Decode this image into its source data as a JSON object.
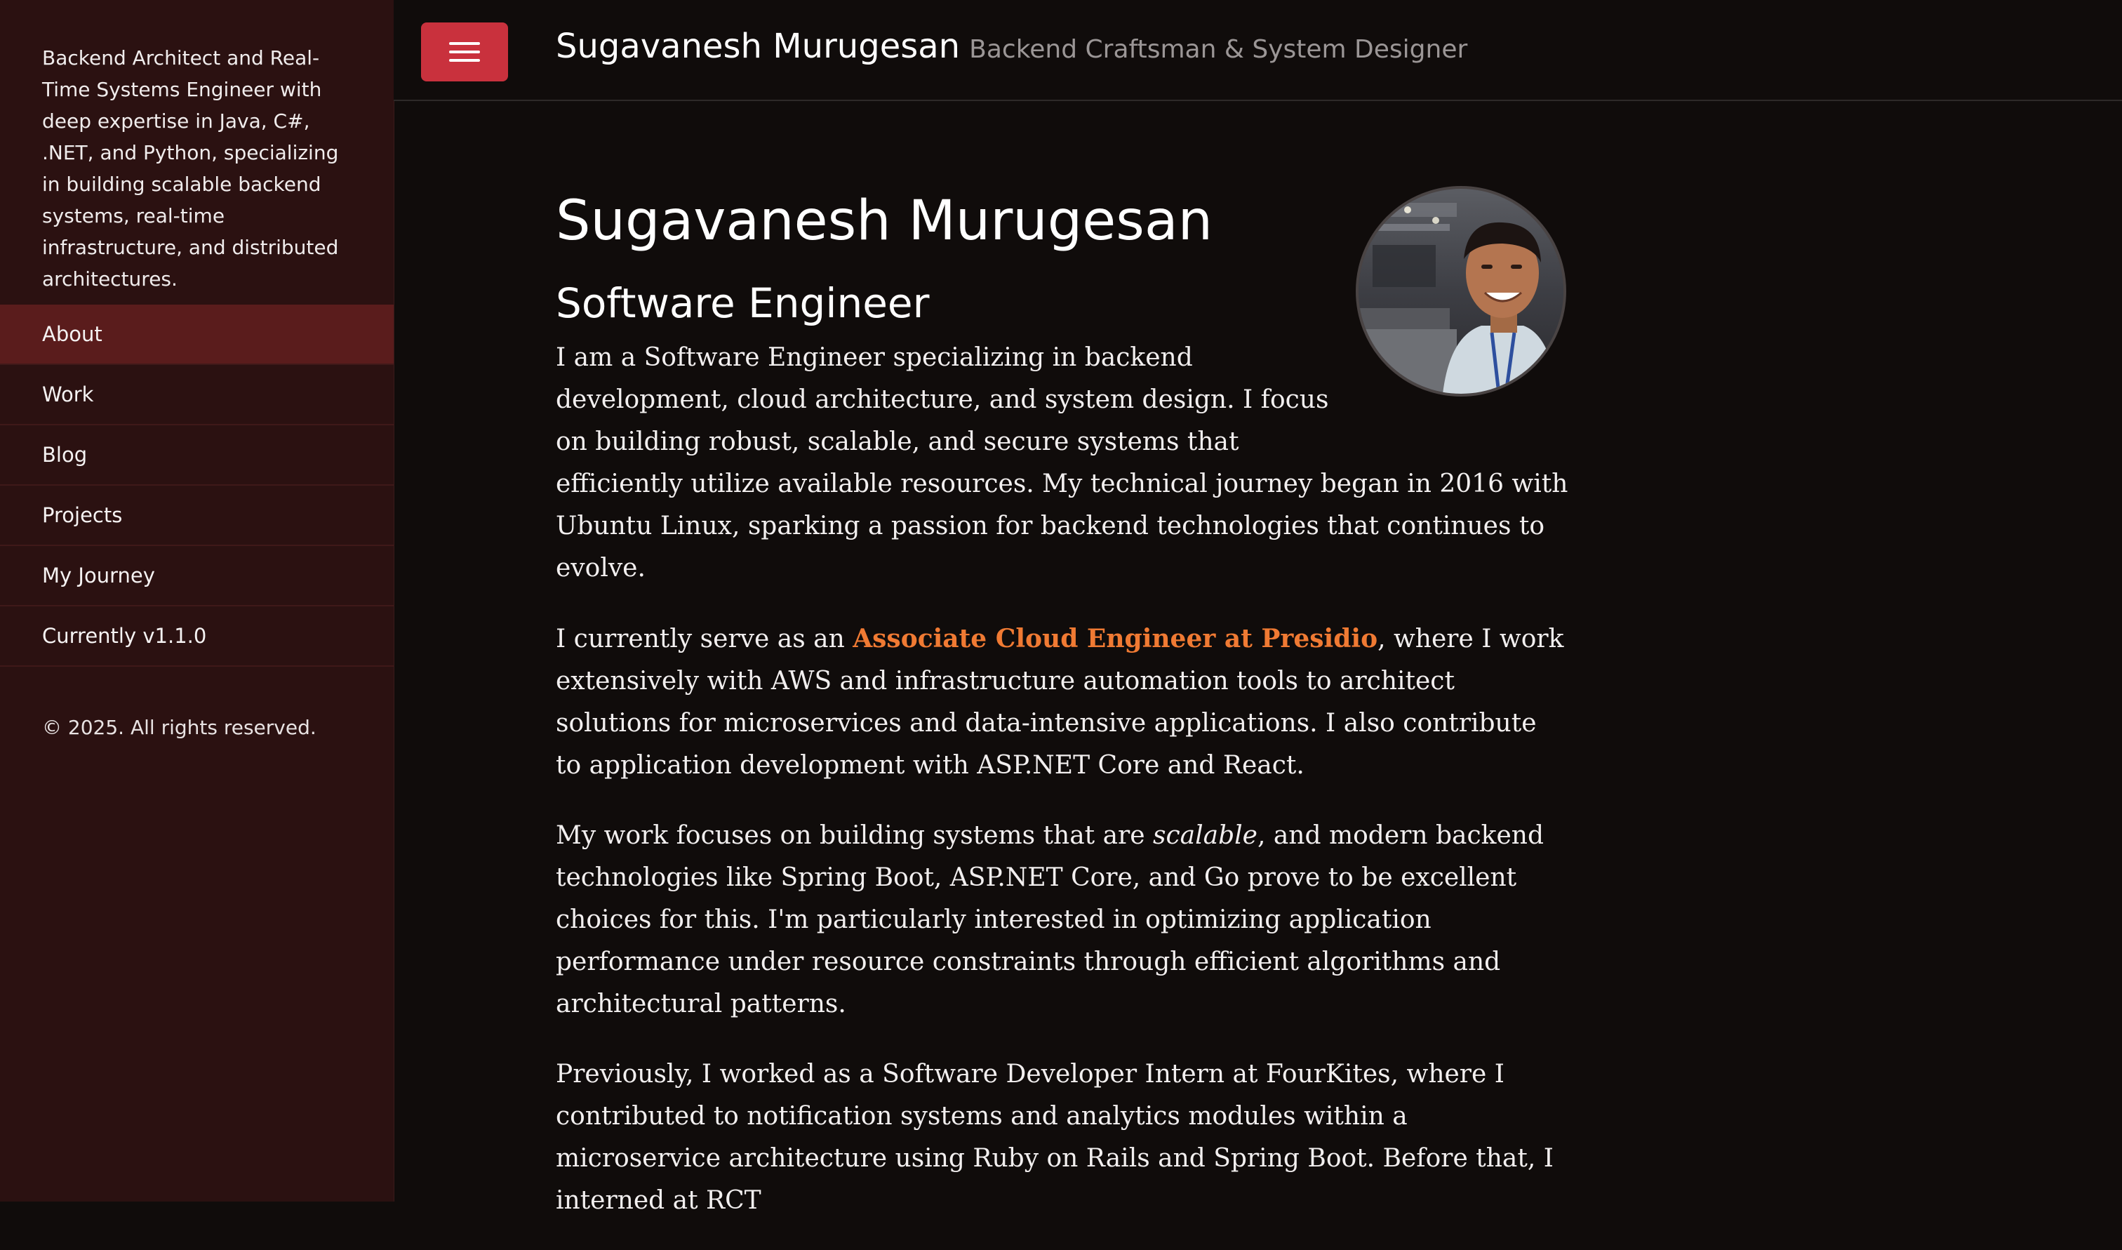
{
  "sidebar": {
    "intro": "Backend Architect and Real-Time Systems Engineer with deep expertise in Java, C#, .NET, and Python, specializing in building scalable backend systems, real-time infrastructure, and distributed architectures.",
    "nav": [
      {
        "label": "About",
        "active": true
      },
      {
        "label": "Work"
      },
      {
        "label": "Blog"
      },
      {
        "label": "Projects"
      },
      {
        "label": "My Journey"
      },
      {
        "label": "Currently v1.1.0"
      }
    ],
    "copyright": "© 2025. All rights reserved."
  },
  "header": {
    "menu_icon": "hamburger-menu-icon",
    "site_name": "Sugavanesh Murugesan",
    "tagline": "Backend Craftsman & System Designer"
  },
  "main": {
    "title": "Sugavanesh Murugesan",
    "subtitle": "Software Engineer",
    "avatar_image": "profile-photo",
    "p1": "I am a Software Engineer specializing in backend development, cloud architecture, and system design. I focus on building robust, scalable, and secure systems that efficiently utilize available resources. My technical journey began in 2016 with Ubuntu Linux, sparking a passion for backend technologies that continues to evolve.",
    "p2_before": "I currently serve as an ",
    "p2_link": "Associate Cloud Engineer at Presidio",
    "p2_after": ", where I work extensively with AWS and infrastructure automation tools to architect solutions for microservices and data-intensive applications. I also contribute to application development with ASP.NET Core and React.",
    "p3_before": "My work focuses on building systems that are ",
    "p3_em": "scalable",
    "p3_after": ", and modern backend technologies like Spring Boot, ASP.NET Core, and Go prove to be excellent choices for this. I'm particularly interested in optimizing application performance under resource constraints through efficient algorithms and architectural patterns.",
    "p4": "Previously, I worked as a Software Developer Intern at FourKites, where I contributed to notification systems and analytics modules within a microservice architecture using Ruby on Rails and Spring Boot. Before that, I interned at RCT"
  },
  "colors": {
    "sidebar_bg": "#2b1111",
    "nav_active_bg": "#5a1c1c",
    "page_bg": "#100c0b",
    "menu_button": "#c9313d",
    "link": "#f07a33"
  }
}
